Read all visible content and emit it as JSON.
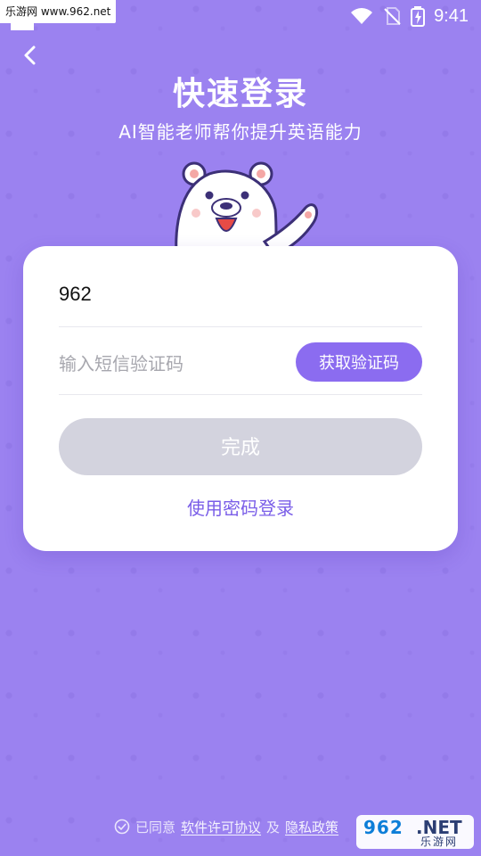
{
  "status_bar": {
    "watermark_text": "乐游网 www.962.net",
    "time": "9:41",
    "icons": [
      "wifi-icon",
      "no-sim-icon",
      "battery-icon"
    ]
  },
  "header": {
    "back_icon": "back-arrow-icon",
    "title": "快速登录",
    "subtitle": "AI智能老师帮你提升英语能力"
  },
  "mascot": {
    "name": "bear-mascot"
  },
  "login_card": {
    "phone_value": "962",
    "sms_placeholder": "输入短信验证码",
    "get_code_label": "获取验证码",
    "submit_label": "完成",
    "password_login_label": "使用密码登录"
  },
  "agreement": {
    "prefix": "已同意",
    "software_license": "软件许可协议",
    "and": "及",
    "privacy": "隐私政策"
  },
  "watermark": {
    "logo_text": "962",
    "net_text": ".NET",
    "site_name": "乐游网"
  },
  "colors": {
    "background": "#9b82f0",
    "accent": "#8b6cf0",
    "disabled_button": "#d3d3de"
  }
}
